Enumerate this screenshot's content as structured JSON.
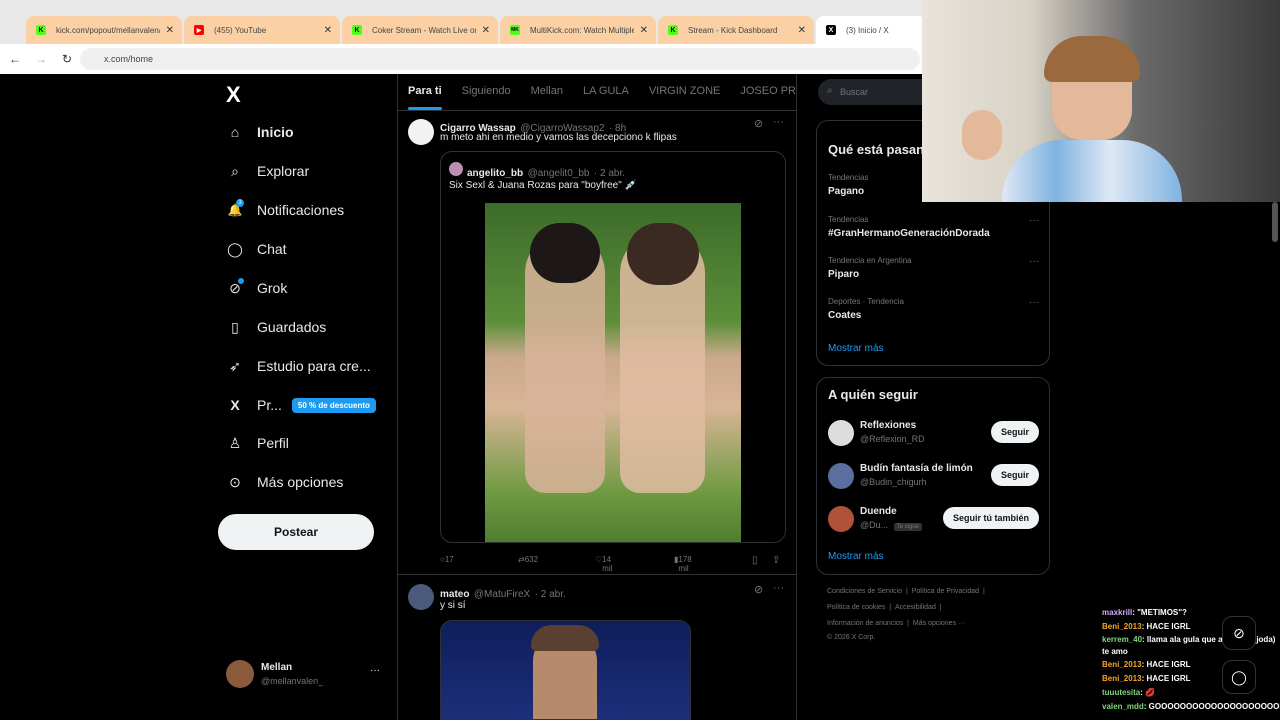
{
  "browser": {
    "tabs": [
      {
        "title": "kick.com/popout/mellanvalen/c",
        "favicon": "K",
        "favicon_color": "#53fc18",
        "active": false
      },
      {
        "title": "(455) YouTube",
        "favicon": "▶",
        "favicon_color": "#ff0000",
        "active": false
      },
      {
        "title": "Coker Stream - Watch Live or",
        "favicon": "K",
        "favicon_color": "#53fc18",
        "active": false
      },
      {
        "title": "MultiKick.com: Watch Multiple",
        "favicon": "MK",
        "favicon_color": "#53fc18",
        "active": false
      },
      {
        "title": "Stream - Kick Dashboard",
        "favicon": "K",
        "favicon_color": "#53fc18",
        "active": false
      },
      {
        "title": "(3) Inicio / X",
        "favicon": "X",
        "favicon_color": "#000000",
        "active": true
      }
    ],
    "url": "x.com/home"
  },
  "sidebar": {
    "logo": "X",
    "items": [
      {
        "label": "Inicio",
        "icon": "home-icon",
        "glyph": "⌂"
      },
      {
        "label": "Explorar",
        "icon": "search-icon",
        "glyph": "⌕"
      },
      {
        "label": "Notificaciones",
        "icon": "bell-icon",
        "glyph": "🔔",
        "badge_count": "3"
      },
      {
        "label": "Chat",
        "icon": "chat-icon",
        "glyph": "◯"
      },
      {
        "label": "Grok",
        "icon": "grok-icon",
        "glyph": "⊘"
      },
      {
        "label": "Guardados",
        "icon": "bookmark-icon",
        "glyph": "▯"
      },
      {
        "label": "Estudio para cre...",
        "icon": "rocket-icon",
        "glyph": "➶"
      },
      {
        "label": "Pr...",
        "icon": "x-premium-icon",
        "glyph": "X",
        "badge": "50 % de descuento"
      },
      {
        "label": "Perfil",
        "icon": "person-icon",
        "glyph": "♙"
      },
      {
        "label": "Más opciones",
        "icon": "more-circle-icon",
        "glyph": "⊙"
      }
    ],
    "post_label": "Postear",
    "user": {
      "name": "Mellan",
      "handle": "@mellanvalen_",
      "more": "···"
    }
  },
  "main": {
    "tabs": [
      "Para ti",
      "Siguiendo",
      "Mellan",
      "LA GULA",
      "VIRGIN ZONE",
      "JOSEO PRIME"
    ],
    "tweets": [
      {
        "name": "Cigarro Wassap",
        "handle": "@CigarroWassap2",
        "time": "· 8h",
        "text": "m meto ahi en medio y vamos las decepciono k flipas",
        "quote": {
          "name": "angelito_bb",
          "handle": "@angelit0_bb",
          "time": "· 2 abr.",
          "text": "Six Sexl & Juana Rozas para \"boyfree\" 💉"
        },
        "replies": "17",
        "retweets": "632",
        "likes": "14 mil",
        "views": "178 mil"
      },
      {
        "name": "mateo",
        "handle": "@MatuFireX",
        "time": "· 2 abr.",
        "text": "y si sí"
      }
    ]
  },
  "right": {
    "search_placeholder": "Buscar",
    "trends_title": "Qué está pasando",
    "trends": [
      {
        "category": "Tendencias",
        "name": "Pagano"
      },
      {
        "category": "Tendencias",
        "name": "#GranHermanoGeneraciónDorada"
      },
      {
        "category": "Tendencia en Argentina",
        "name": "Piparo"
      },
      {
        "category": "Deportes · Tendencia",
        "name": "Coates"
      }
    ],
    "show_more": "Mostrar más",
    "follow_title": "A quién seguir",
    "follow": [
      {
        "name": "Reflexiones",
        "handle": "@Reflexion_RD",
        "button": "Seguir"
      },
      {
        "name": "Budín fantasía de limón",
        "handle": "@Budin_chigurh",
        "button": "Seguir"
      },
      {
        "name": "Duende",
        "handle": "@Du...",
        "follows_you": "Te sigue",
        "button": "Seguir tú también"
      }
    ],
    "footer": {
      "line1": [
        "Condiciones de Servicio",
        "|",
        "Política de Privacidad",
        "|"
      ],
      "line2": [
        "Política de cookies",
        "|",
        "Accesibilidad",
        "|"
      ],
      "line3": [
        "Información de anuncios",
        "|",
        "Más opciones ···"
      ],
      "copyright": "© 2026 X Corp."
    }
  },
  "chat_overlay": {
    "messages": [
      {
        "user": "maxkrill",
        "text": ": \"METIMOS\"?"
      },
      {
        "user": "Beni_2013",
        "text": ": HACE IGRL"
      },
      {
        "user": "kerrem_40",
        "text": ": llama ala gula que acarrean (joda) te amo"
      },
      {
        "user": "Beni_2013",
        "text": ": HACE IGRL"
      },
      {
        "user": "Beni_2013",
        "text": ": HACE IGRL"
      },
      {
        "user": "tuuutesita",
        "text": ": 💋"
      },
      {
        "user": "valen_mdd",
        "text": ": GOOOOOOOOOOOOOOOOOOOOL"
      }
    ]
  },
  "colors": {
    "accent": "#1d9bf0",
    "bg": "#000000",
    "border": "#2f3336",
    "muted": "#71767b"
  }
}
